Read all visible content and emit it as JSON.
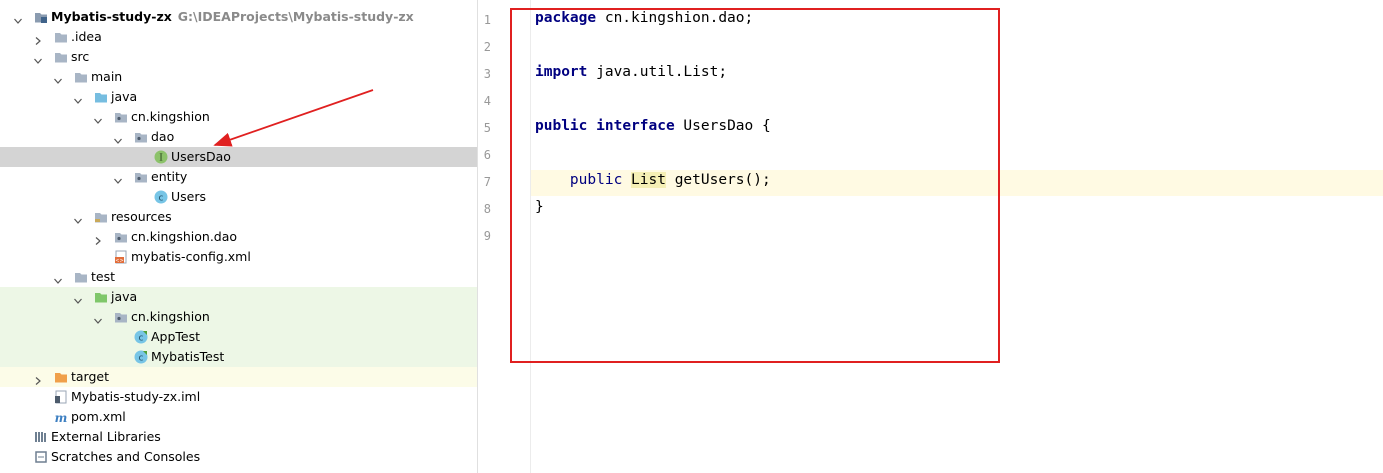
{
  "project": {
    "name": "Mybatis-study-zx",
    "path": "G:\\IDEAProjects\\Mybatis-study-zx"
  },
  "tree": [
    {
      "label": "Mybatis-study-zx",
      "depth": 0,
      "expanded": true,
      "icon": "project-folder-icon",
      "name": "project-root"
    },
    {
      "label": ".idea",
      "depth": 1,
      "expanded": false,
      "icon": "folder-icon",
      "name": "idea-folder"
    },
    {
      "label": "src",
      "depth": 1,
      "expanded": true,
      "icon": "folder-icon",
      "name": "src-folder"
    },
    {
      "label": "main",
      "depth": 2,
      "expanded": true,
      "icon": "folder-icon",
      "name": "main-folder"
    },
    {
      "label": "java",
      "depth": 3,
      "expanded": true,
      "icon": "source-root-icon",
      "name": "java-folder"
    },
    {
      "label": "cn.kingshion",
      "depth": 4,
      "expanded": true,
      "icon": "package-icon",
      "name": "package-kingshion"
    },
    {
      "label": "dao",
      "depth": 5,
      "expanded": true,
      "icon": "package-icon",
      "name": "package-dao"
    },
    {
      "label": "UsersDao",
      "depth": 6,
      "icon": "interface-icon",
      "name": "file-usersdao",
      "selected": true
    },
    {
      "label": "entity",
      "depth": 5,
      "expanded": true,
      "icon": "package-icon",
      "name": "package-entity"
    },
    {
      "label": "Users",
      "depth": 6,
      "icon": "class-icon",
      "name": "file-users"
    },
    {
      "label": "resources",
      "depth": 3,
      "expanded": true,
      "icon": "resources-icon",
      "name": "resources-folder"
    },
    {
      "label": "cn.kingshion.dao",
      "depth": 4,
      "expanded": false,
      "icon": "package-icon",
      "name": "resources-package"
    },
    {
      "label": "mybatis-config.xml",
      "depth": 4,
      "icon": "xml-icon",
      "name": "file-mybatis-config"
    },
    {
      "label": "test",
      "depth": 2,
      "expanded": true,
      "icon": "folder-icon",
      "name": "test-folder"
    },
    {
      "label": "java",
      "depth": 3,
      "expanded": true,
      "icon": "test-root-icon",
      "name": "test-java-folder",
      "test": true
    },
    {
      "label": "cn.kingshion",
      "depth": 4,
      "expanded": true,
      "icon": "package-icon",
      "name": "test-package",
      "test": true
    },
    {
      "label": "AppTest",
      "depth": 5,
      "icon": "test-class-icon",
      "name": "file-apptest",
      "test": true
    },
    {
      "label": "MybatisTest",
      "depth": 5,
      "icon": "test-class-icon",
      "name": "file-mybatistest",
      "test": true
    },
    {
      "label": "target",
      "depth": 1,
      "expanded": false,
      "icon": "excluded-folder-icon",
      "name": "target-folder",
      "excluded": true
    },
    {
      "label": "Mybatis-study-zx.iml",
      "depth": 1,
      "icon": "iml-icon",
      "name": "file-iml"
    },
    {
      "label": "pom.xml",
      "depth": 1,
      "icon": "maven-icon",
      "name": "file-pom"
    },
    {
      "label": "External Libraries",
      "depth": 0,
      "icon": "libraries-icon",
      "name": "external-libraries"
    },
    {
      "label": "Scratches and Consoles",
      "depth": 0,
      "icon": "scratches-icon",
      "name": "scratches-consoles"
    }
  ],
  "editor": {
    "line_numbers": [
      "1",
      "2",
      "3",
      "4",
      "5",
      "6",
      "7",
      "8",
      "9"
    ],
    "l1": {
      "kw": "package",
      "rest": " cn.kingshion.dao;"
    },
    "l3": {
      "kw": "import",
      "rest": " java.util.List;"
    },
    "l5": {
      "kw1": "public",
      "kw2": "interface",
      "rest": " UsersDao {"
    },
    "l7": {
      "indent": "    ",
      "kw": "public",
      "sp": " ",
      "type": "List",
      "rest": " getUsers();"
    },
    "l8": {
      "text": "}"
    }
  },
  "colors": {
    "annotation_red": "#e02020",
    "keyword": "#000080",
    "caret_line": "#fffae3",
    "selection": "#d4d4d4"
  }
}
